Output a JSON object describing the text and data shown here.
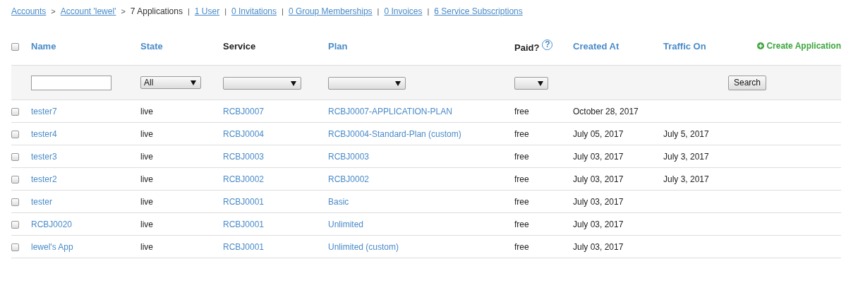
{
  "breadcrumb": [
    {
      "kind": "link",
      "text": "Accounts"
    },
    {
      "kind": "separator",
      "text": ">"
    },
    {
      "kind": "link",
      "text": "Account 'lewel'"
    },
    {
      "kind": "separator",
      "text": ">"
    },
    {
      "kind": "current",
      "text": "7 Applications"
    },
    {
      "kind": "separator",
      "text": "|"
    },
    {
      "kind": "link",
      "text": "1 User"
    },
    {
      "kind": "separator",
      "text": "|"
    },
    {
      "kind": "link",
      "text": "0 Invitations"
    },
    {
      "kind": "separator",
      "text": "|"
    },
    {
      "kind": "link",
      "text": "0 Group Memberships"
    },
    {
      "kind": "separator",
      "text": "|"
    },
    {
      "kind": "link",
      "text": "0 Invoices"
    },
    {
      "kind": "separator",
      "text": "|"
    },
    {
      "kind": "link",
      "text": "6 Service Subscriptions"
    }
  ],
  "table": {
    "select_all": {
      "checked": false
    },
    "columns": [
      {
        "label": "Name",
        "sortable": true
      },
      {
        "label": "State",
        "sortable": true
      },
      {
        "label": "Service",
        "sortable": false
      },
      {
        "label": "Plan",
        "sortable": true
      },
      {
        "label": "Paid?",
        "sortable": false,
        "help": "?"
      },
      {
        "label": "Created At",
        "sortable": true
      },
      {
        "label": "Traffic On",
        "sortable": true
      }
    ],
    "create_link": "Create Application",
    "filters": [
      {
        "kind": "text"
      },
      {
        "kind": "select",
        "value": "All"
      },
      {
        "kind": "select"
      },
      {
        "kind": "select"
      },
      {
        "kind": "select"
      }
    ],
    "search_button": "Search",
    "rows": [
      {
        "checked": false,
        "name": "tester7",
        "state": "live",
        "service": "RCBJ0007",
        "plan": "RCBJ0007-APPLICATION-PLAN",
        "paid": "free",
        "created_at": "October 28, 2017"
      },
      {
        "checked": false,
        "name": "tester4",
        "state": "live",
        "service": "RCBJ0004",
        "plan": "RCBJ0004-Standard-Plan (custom)",
        "paid": "free",
        "created_at": "July 05, 2017",
        "traffic_on": "July 5, 2017"
      },
      {
        "checked": false,
        "name": "tester3",
        "state": "live",
        "service": "RCBJ0003",
        "plan": "RCBJ0003",
        "paid": "free",
        "created_at": "July 03, 2017",
        "traffic_on": "July 3, 2017"
      },
      {
        "checked": false,
        "name": "tester2",
        "state": "live",
        "service": "RCBJ0002",
        "plan": "RCBJ0002",
        "paid": "free",
        "created_at": "July 03, 2017",
        "traffic_on": "July 3, 2017"
      },
      {
        "checked": false,
        "name": "tester",
        "state": "live",
        "service": "RCBJ0001",
        "plan": "Basic",
        "paid": "free",
        "created_at": "July 03, 2017"
      },
      {
        "checked": false,
        "name": "RCBJ0020",
        "state": "live",
        "service": "RCBJ0001",
        "plan": "Unlimited",
        "paid": "free",
        "created_at": "July 03, 2017"
      },
      {
        "checked": false,
        "name": "lewel's App",
        "state": "live",
        "service": "RCBJ0001",
        "plan": "Unlimited (custom)",
        "paid": "free",
        "created_at": "July 03, 2017"
      }
    ]
  }
}
